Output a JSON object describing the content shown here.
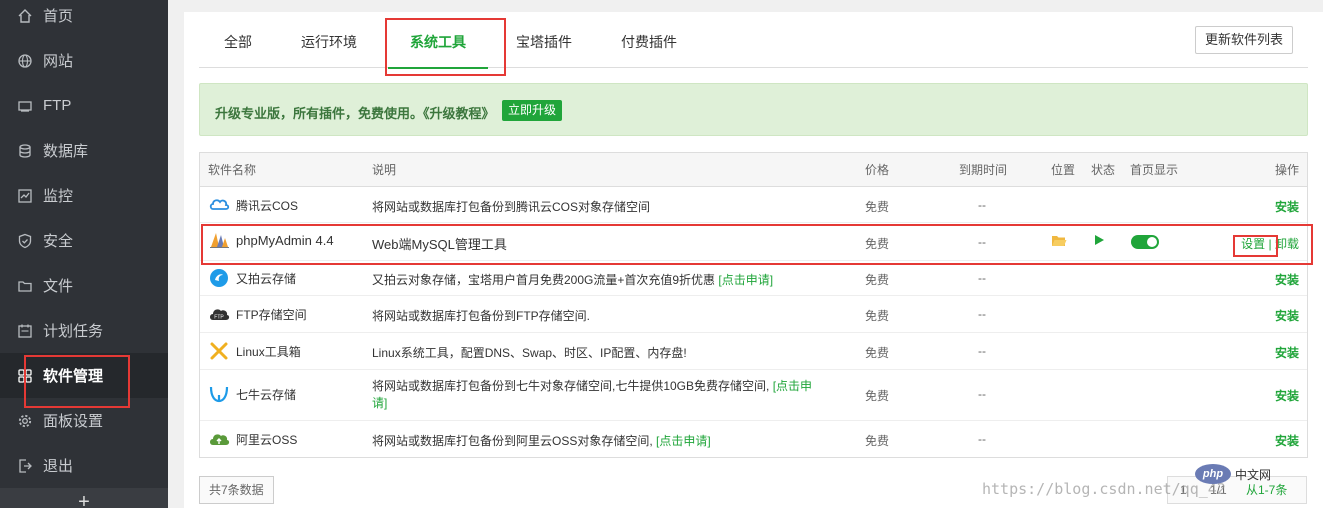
{
  "sidebar": {
    "items": [
      {
        "label": "首页",
        "icon": "home-icon"
      },
      {
        "label": "网站",
        "icon": "globe-icon"
      },
      {
        "label": "FTP",
        "icon": "ftp-icon"
      },
      {
        "label": "数据库",
        "icon": "database-icon"
      },
      {
        "label": "监控",
        "icon": "monitor-icon"
      },
      {
        "label": "安全",
        "icon": "shield-icon"
      },
      {
        "label": "文件",
        "icon": "folder-icon"
      },
      {
        "label": "计划任务",
        "icon": "calendar-icon"
      },
      {
        "label": "软件管理",
        "icon": "apps-icon",
        "active": true
      },
      {
        "label": "面板设置",
        "icon": "gear-icon"
      },
      {
        "label": "退出",
        "icon": "logout-icon"
      }
    ],
    "plus": "+"
  },
  "tabs": [
    {
      "label": "全部"
    },
    {
      "label": "运行环境"
    },
    {
      "label": "系统工具",
      "active": true
    },
    {
      "label": "宝塔插件"
    },
    {
      "label": "付费插件"
    }
  ],
  "refresh_button": "更新软件列表",
  "alert": {
    "text": "升级专业版，所有插件，免费使用。《升级教程》",
    "button": "立即升级"
  },
  "table": {
    "headers": {
      "name": "软件名称",
      "desc": "说明",
      "price": "价格",
      "expire": "到期时间",
      "location": "位置",
      "status": "状态",
      "homepage": "首页显示",
      "actions": "操作"
    },
    "rows": [
      {
        "name": "腾讯云COS",
        "icon": "cloud-cos-icon",
        "desc": "将网站或数据库打包备份到腾讯云COS对象存储空间",
        "link": "",
        "price": "免费",
        "expire": "--",
        "action": "安装"
      },
      {
        "name": "phpMyAdmin 4.4",
        "icon": "phpmyadmin-icon",
        "desc": "Web端MySQL管理工具",
        "link": "",
        "price": "免费",
        "expire": "--",
        "installed": true,
        "action_set": "设置",
        "action_sep": "|",
        "action_uninstall": "卸载"
      },
      {
        "name": "又拍云存储",
        "icon": "upyun-icon",
        "desc": "又拍云对象存储，宝塔用户首月免费200G流量+首次充值9折优惠 ",
        "link": "[点击申请]",
        "price": "免费",
        "expire": "--",
        "action": "安装"
      },
      {
        "name": "FTP存储空间",
        "icon": "ftp-cloud-icon",
        "desc": "将网站或数据库打包备份到FTP存储空间.",
        "link": "",
        "price": "免费",
        "expire": "--",
        "action": "安装"
      },
      {
        "name": "Linux工具箱",
        "icon": "toolbox-icon",
        "desc": "Linux系统工具，配置DNS、Swap、时区、IP配置、内存盘!",
        "link": "",
        "price": "免费",
        "expire": "--",
        "action": "安装"
      },
      {
        "name": "七牛云存储",
        "icon": "qiniu-icon",
        "desc": "将网站或数据库打包备份到七牛对象存储空间,七牛提供10GB免费存储空间, ",
        "link": "[点击申请]",
        "price": "免费",
        "expire": "--",
        "action": "安装"
      },
      {
        "name": "阿里云OSS",
        "icon": "aliyun-icon",
        "desc": "将网站或数据库打包备份到阿里云OSS对象存储空间, ",
        "link": "[点击申请]",
        "price": "免费",
        "expire": "--",
        "action": "安装"
      }
    ]
  },
  "footer": {
    "total": "共7条数据",
    "pager_current": "1",
    "pager_page": "1/1",
    "pager_range": "从1-7条"
  },
  "watermark": "https://blog.csdn.net/qq_42",
  "php_logo": {
    "badge": "php",
    "text": "中文网"
  },
  "colors": {
    "accent": "#20a53a",
    "sidebar": "#2f3237",
    "highlight": "#e53935"
  }
}
